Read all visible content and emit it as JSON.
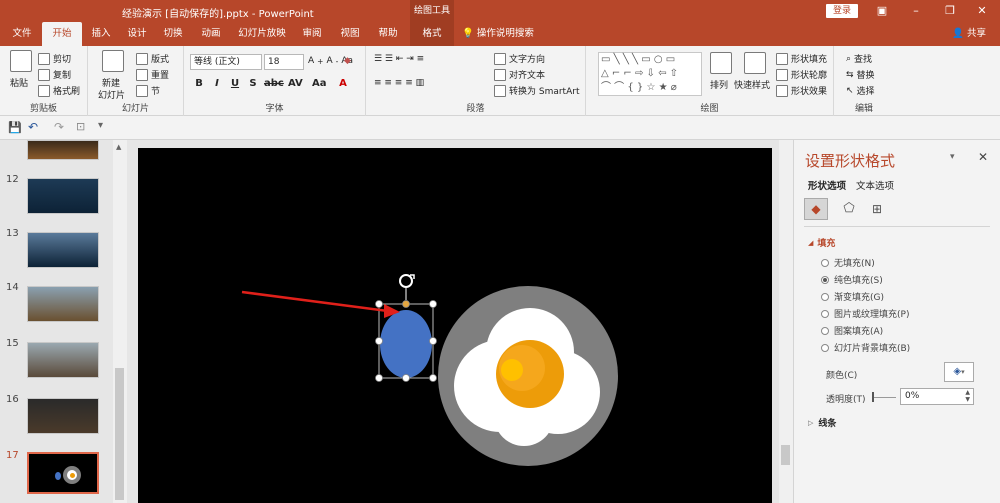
{
  "titlebar": {
    "title": "经验演示 [自动保存的].pptx  -  PowerPoint",
    "context_group": "绘图工具",
    "login": "登录"
  },
  "tabs": [
    {
      "label": "文件"
    },
    {
      "label": "开始"
    },
    {
      "label": "插入"
    },
    {
      "label": "设计"
    },
    {
      "label": "切换"
    },
    {
      "label": "动画"
    },
    {
      "label": "幻灯片放映"
    },
    {
      "label": "审阅"
    },
    {
      "label": "视图"
    },
    {
      "label": "帮助"
    },
    {
      "label": "格式"
    }
  ],
  "tellme": "操作说明搜索",
  "share": "共享",
  "ribbon": {
    "clipboard": {
      "paste": "粘贴",
      "cut": "剪切",
      "copy": "复制",
      "painter": "格式刷",
      "label": "剪贴板"
    },
    "slides": {
      "new_slide_1": "新建",
      "new_slide_2": "幻灯片",
      "layout": "版式",
      "reset": "重置",
      "section": "节",
      "label": "幻灯片"
    },
    "font": {
      "name": "等线 (正文)",
      "size": "18",
      "label": "字体"
    },
    "paragraph": {
      "text_dir": "文字方向",
      "align_text": "对齐文本",
      "smartart": "转换为 SmartArt",
      "label": "段落"
    },
    "drawing": {
      "arrange": "排列",
      "quick_styles": "快速样式",
      "fill": "形状填充",
      "outline": "形状轮廓",
      "effects": "形状效果",
      "label": "绘图"
    },
    "editing": {
      "find": "查找",
      "replace": "替换",
      "select": "选择",
      "label": "编辑"
    }
  },
  "slides": [
    {
      "num": "12"
    },
    {
      "num": "13"
    },
    {
      "num": "14"
    },
    {
      "num": "15"
    },
    {
      "num": "16"
    },
    {
      "num": "17"
    }
  ],
  "pane": {
    "title": "设置形状格式",
    "tab_shape": "形状选项",
    "tab_text": "文本选项",
    "fill_header": "填充",
    "fill_options": [
      {
        "label": "无填充(N)",
        "selected": false
      },
      {
        "label": "纯色填充(S)",
        "selected": true
      },
      {
        "label": "渐变填充(G)",
        "selected": false
      },
      {
        "label": "图片或纹理填充(P)",
        "selected": false
      },
      {
        "label": "图案填充(A)",
        "selected": false
      },
      {
        "label": "幻灯片背景填充(B)",
        "selected": false
      }
    ],
    "color_label": "颜色(C)",
    "transparency_label": "透明度(T)",
    "transparency_value": "0%",
    "line_header": "线条"
  },
  "colors": {
    "accent": "#b7472a",
    "shape_fill": "#4472c4",
    "plate": "#7f7f7f",
    "yolk": "#ed9c09",
    "arrow": "#e0201a"
  }
}
